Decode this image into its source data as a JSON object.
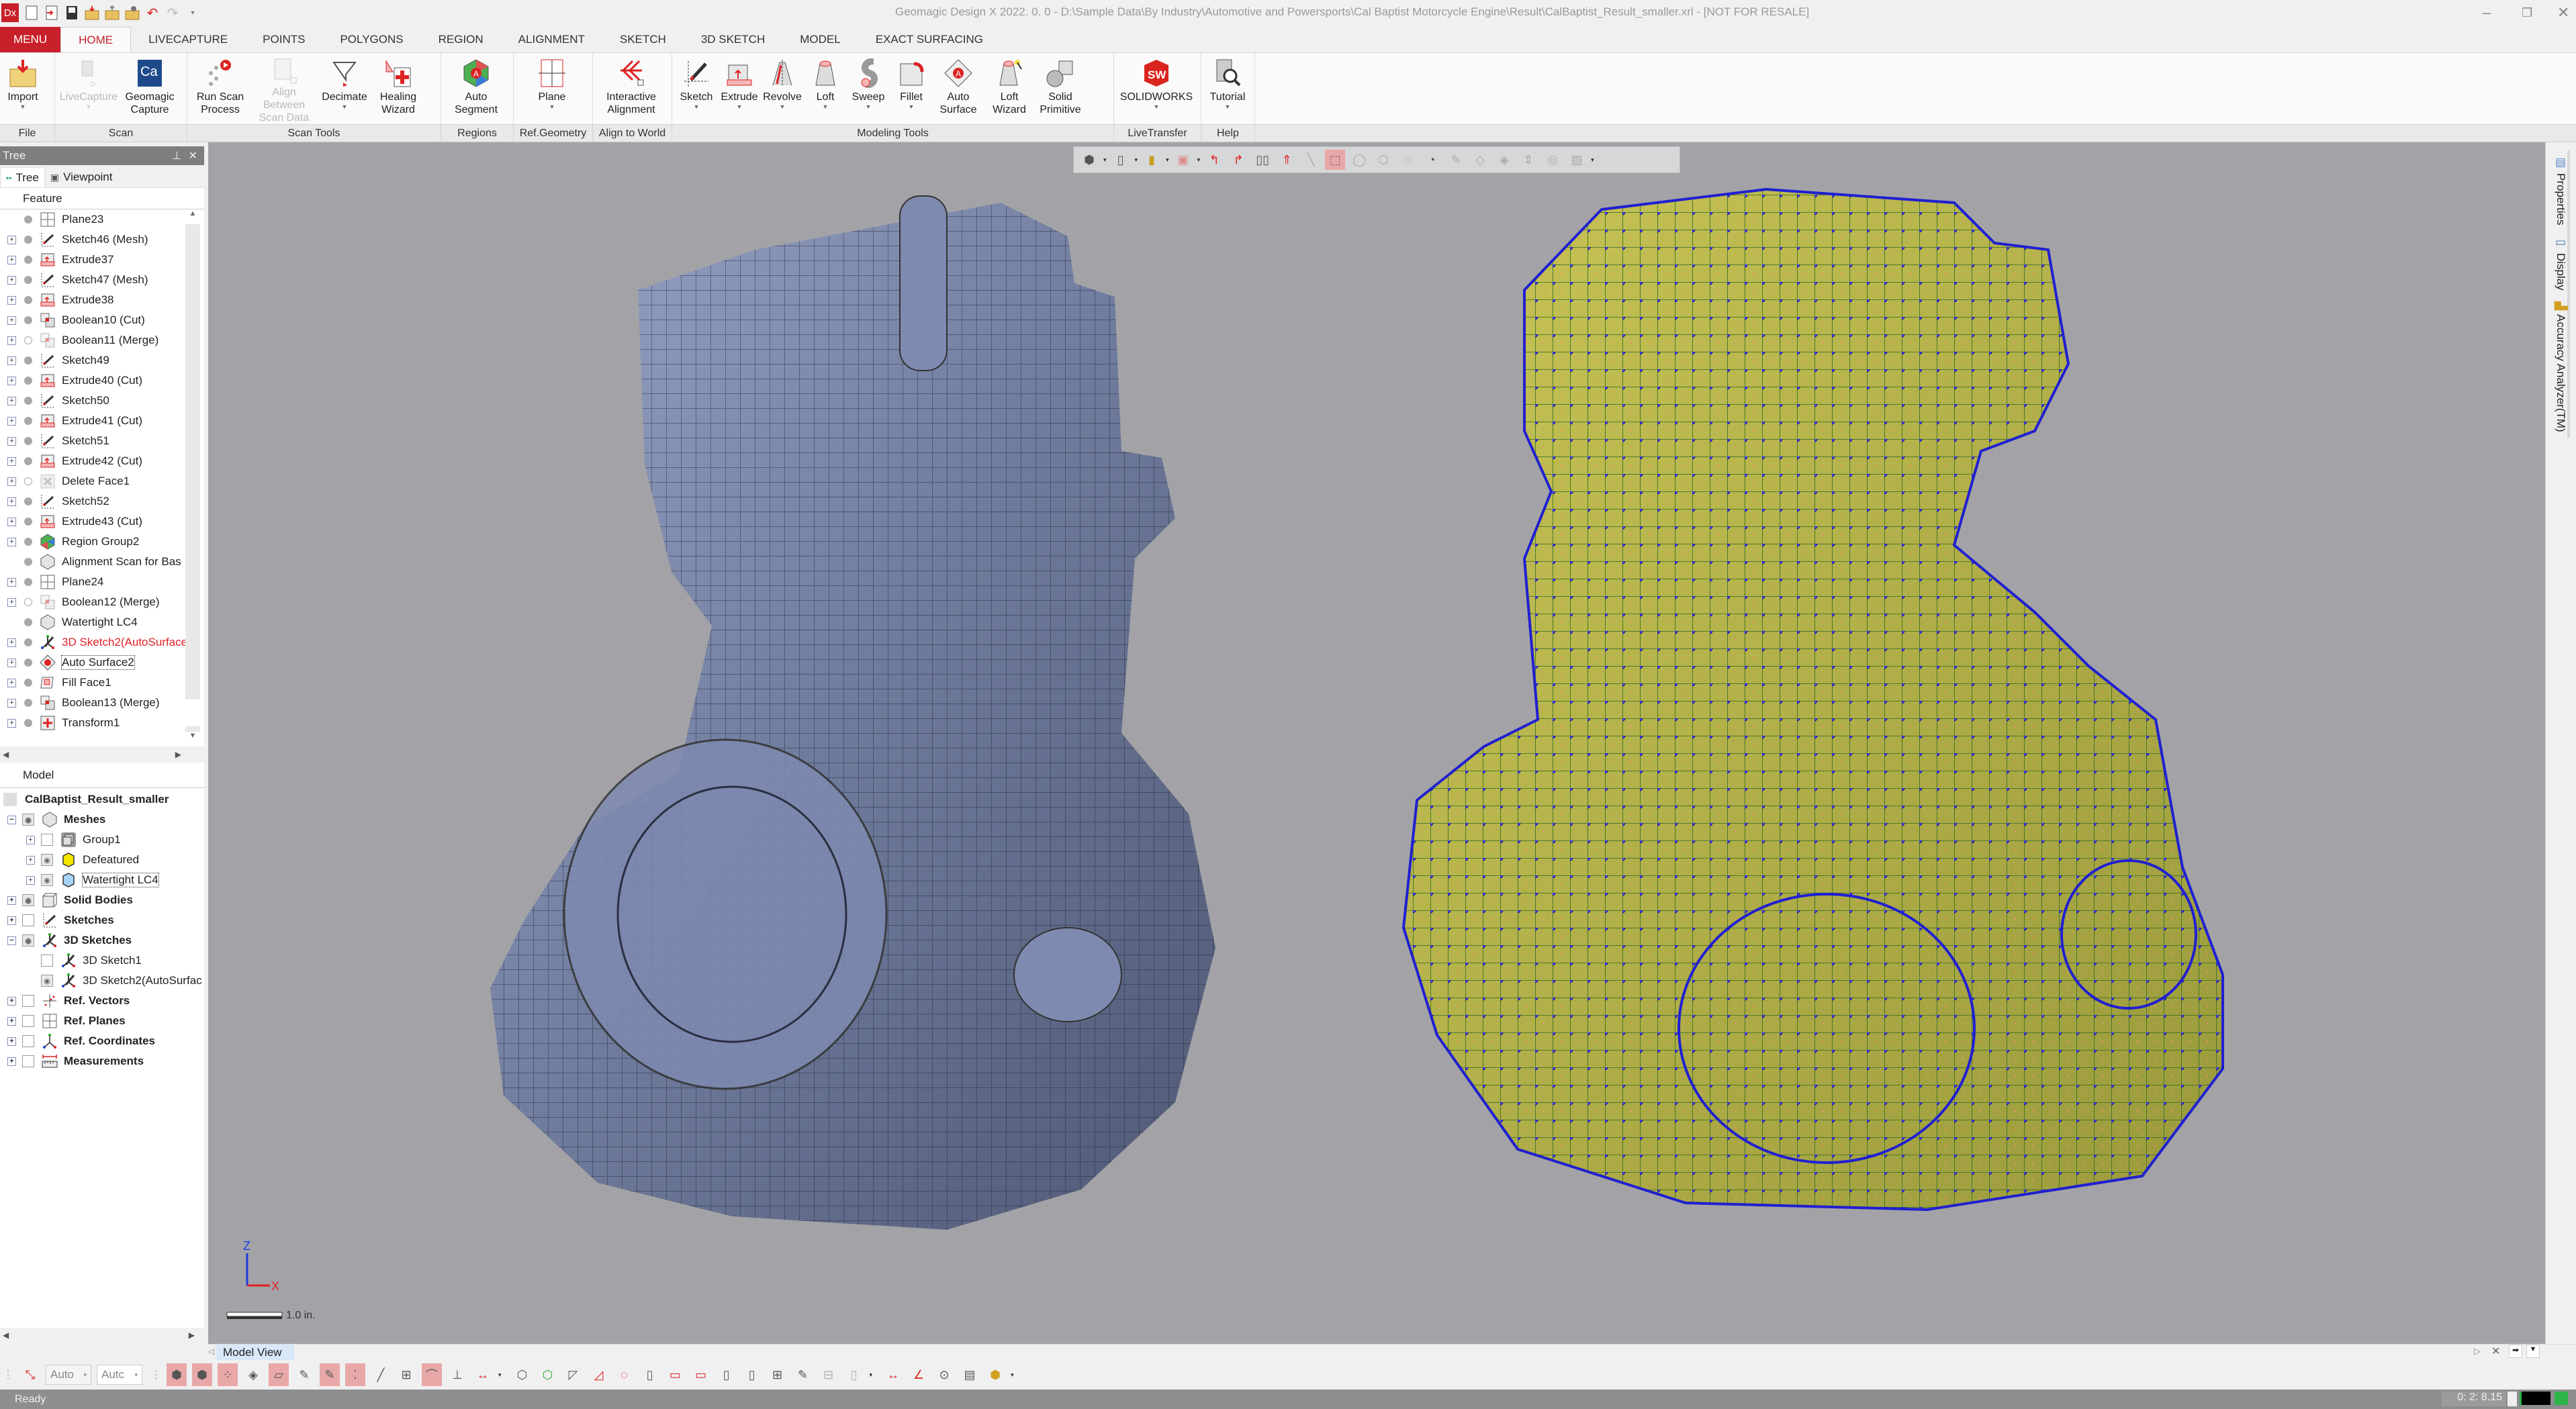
{
  "app": {
    "logo": "Dx",
    "title": "Geomagic Design X 2022. 0. 0 - D:\\Sample Data\\By Industry\\Automotive and Powersports\\Cal Baptist Motorcycle Engine\\Result\\CalBaptist_Result_smaller.xrl - [NOT FOR RESALE]",
    "window_controls": [
      "minimize",
      "restore",
      "close"
    ],
    "quick_access": [
      "new-file-icon",
      "import-file-icon",
      "save-icon",
      "open-folder-icon",
      "export-folder-icon",
      "settings-folder-icon",
      "undo-icon",
      "redo-icon",
      "customize-icon"
    ]
  },
  "ribbon": {
    "menu_label": "MENU",
    "tabs": [
      "HOME",
      "LIVECAPTURE",
      "POINTS",
      "POLYGONS",
      "REGION",
      "ALIGNMENT",
      "SKETCH",
      "3D SKETCH",
      "MODEL",
      "EXACT SURFACING"
    ],
    "active_tab": "HOME",
    "groups": [
      {
        "label": "File",
        "buttons": [
          {
            "label": "Import",
            "icon": "import-icon",
            "dropdown": true
          }
        ]
      },
      {
        "label": "Scan",
        "buttons": [
          {
            "label": "LiveCapture",
            "icon": "livecapture-icon",
            "dropdown": true,
            "disabled": true
          },
          {
            "label": "Geomagic\nCapture",
            "icon": "geomagic-capture-icon",
            "dropdown": true
          }
        ]
      },
      {
        "label": "Scan Tools",
        "buttons": [
          {
            "label": "Run Scan\nProcess",
            "icon": "run-scan-process-icon",
            "dropdown": true
          },
          {
            "label": "Align Between\nScan Data",
            "icon": "align-between-icon",
            "disabled": true
          },
          {
            "label": "Decimate",
            "icon": "decimate-icon",
            "dropdown": true
          },
          {
            "label": "Healing\nWizard",
            "icon": "healing-wizard-icon"
          }
        ]
      },
      {
        "label": "Regions",
        "buttons": [
          {
            "label": "Auto\nSegment",
            "icon": "auto-segment-icon",
            "dropdown": true
          }
        ]
      },
      {
        "label": "Ref.Geometry",
        "buttons": [
          {
            "label": "Plane",
            "icon": "plane-icon",
            "dropdown": true
          }
        ]
      },
      {
        "label": "Align to World",
        "buttons": [
          {
            "label": "Interactive\nAlignment",
            "icon": "interactive-alignment-icon",
            "dropdown": true
          }
        ]
      },
      {
        "label": "Modeling Tools",
        "buttons": [
          {
            "label": "Sketch",
            "icon": "sketch-icon",
            "dropdown": true
          },
          {
            "label": "Extrude",
            "icon": "extrude-icon",
            "dropdown": true
          },
          {
            "label": "Revolve",
            "icon": "revolve-icon",
            "dropdown": true
          },
          {
            "label": "Loft",
            "icon": "loft-icon",
            "dropdown": true
          },
          {
            "label": "Sweep",
            "icon": "sweep-icon",
            "dropdown": true
          },
          {
            "label": "Fillet",
            "icon": "fillet-icon",
            "dropdown": true
          },
          {
            "label": "Auto\nSurface",
            "icon": "auto-surface-icon",
            "dropdown": true
          },
          {
            "label": "Loft\nWizard",
            "icon": "loft-wizard-icon",
            "dropdown": true
          },
          {
            "label": "Solid\nPrimitive",
            "icon": "solid-primitive-icon",
            "dropdown": true
          }
        ]
      },
      {
        "label": "LiveTransfer",
        "buttons": [
          {
            "label": "SOLIDWORKS",
            "icon": "solidworks-icon",
            "dropdown": true
          }
        ]
      },
      {
        "label": "Help",
        "buttons": [
          {
            "label": "Tutorial",
            "icon": "tutorial-icon",
            "dropdown": true
          }
        ]
      }
    ]
  },
  "left_panel": {
    "title": "Tree",
    "tabs": [
      "Tree",
      "Viewpoint"
    ],
    "feature_header": "Feature",
    "features": [
      {
        "label": "Plane23",
        "icon": "plane-icon",
        "expandable": false,
        "suppressed": false
      },
      {
        "label": "Sketch46 (Mesh)",
        "icon": "sketch-icon",
        "expandable": true,
        "suppressed": false
      },
      {
        "label": "Extrude37",
        "icon": "extrude-icon",
        "expandable": true,
        "suppressed": false
      },
      {
        "label": "Sketch47 (Mesh)",
        "icon": "sketch-icon",
        "expandable": true,
        "suppressed": false
      },
      {
        "label": "Extrude38",
        "icon": "extrude-icon",
        "expandable": true,
        "suppressed": false
      },
      {
        "label": "Boolean10 (Cut)",
        "icon": "boolean-icon",
        "expandable": true,
        "suppressed": false
      },
      {
        "label": "Boolean11 (Merge)",
        "icon": "boolean-icon",
        "expandable": true,
        "suppressed": true
      },
      {
        "label": "Sketch49",
        "icon": "sketch-icon",
        "expandable": true,
        "suppressed": false
      },
      {
        "label": "Extrude40 (Cut)",
        "icon": "extrude-icon",
        "expandable": true,
        "suppressed": false
      },
      {
        "label": "Sketch50",
        "icon": "sketch-icon",
        "expandable": true,
        "suppressed": false
      },
      {
        "label": "Extrude41 (Cut)",
        "icon": "extrude-icon",
        "expandable": true,
        "suppressed": false
      },
      {
        "label": "Sketch51",
        "icon": "sketch-icon",
        "expandable": true,
        "suppressed": false
      },
      {
        "label": "Extrude42 (Cut)",
        "icon": "extrude-icon",
        "expandable": true,
        "suppressed": false
      },
      {
        "label": "Delete Face1",
        "icon": "delete-face-icon",
        "expandable": true,
        "suppressed": true
      },
      {
        "label": "Sketch52",
        "icon": "sketch-icon",
        "expandable": true,
        "suppressed": false
      },
      {
        "label": "Extrude43 (Cut)",
        "icon": "extrude-icon",
        "expandable": true,
        "suppressed": false
      },
      {
        "label": "Region Group2",
        "icon": "region-group-icon",
        "expandable": true,
        "suppressed": false
      },
      {
        "label": "Alignment Scan for Bas",
        "icon": "mesh-icon",
        "expandable": false,
        "suppressed": false
      },
      {
        "label": "Plane24",
        "icon": "plane-icon",
        "expandable": true,
        "suppressed": false
      },
      {
        "label": "Boolean12 (Merge)",
        "icon": "boolean-icon",
        "expandable": true,
        "suppressed": true
      },
      {
        "label": "Watertight LC4",
        "icon": "mesh-icon",
        "expandable": false,
        "suppressed": false
      },
      {
        "label": "3D Sketch2(AutoSurface",
        "icon": "3d-sketch-icon",
        "expandable": true,
        "suppressed": false,
        "error": true
      },
      {
        "label": "Auto Surface2",
        "icon": "auto-surface-icon",
        "expandable": true,
        "suppressed": false,
        "selected": true
      },
      {
        "label": "Fill Face1",
        "icon": "fill-face-icon",
        "expandable": true,
        "suppressed": false
      },
      {
        "label": "Boolean13 (Merge)",
        "icon": "boolean-icon",
        "expandable": true,
        "suppressed": false
      },
      {
        "label": "Transform1",
        "icon": "transform-icon",
        "expandable": true,
        "suppressed": false
      }
    ],
    "model_header": "Model",
    "model_root": "CalBaptist_Result_smaller",
    "model_items": [
      {
        "label": "Meshes",
        "level": 0,
        "bold": true,
        "expander": "minus",
        "visible": true,
        "icon": "mesh-icon"
      },
      {
        "label": "Group1",
        "level": 1,
        "bold": false,
        "expander": "plus",
        "visible": false,
        "icon": "group-icon"
      },
      {
        "label": "Defeatured",
        "level": 1,
        "bold": false,
        "expander": "plus",
        "visible": true,
        "icon": "yellow-mesh-icon"
      },
      {
        "label": "Watertight LC4",
        "level": 1,
        "bold": false,
        "expander": "plus",
        "visible": true,
        "icon": "blue-mesh-icon",
        "selected": true
      },
      {
        "label": "Solid Bodies",
        "level": 0,
        "bold": true,
        "expander": "plus",
        "visible": true,
        "icon": "solid-body-icon"
      },
      {
        "label": "Sketches",
        "level": 0,
        "bold": true,
        "expander": "plus",
        "visible": false,
        "icon": "sketch-icon"
      },
      {
        "label": "3D Sketches",
        "level": 0,
        "bold": true,
        "expander": "minus",
        "visible": true,
        "icon": "3d-sketch-icon"
      },
      {
        "label": "3D Sketch1",
        "level": 1,
        "bold": false,
        "expander": "none",
        "visible": false,
        "icon": "3d-sketch-icon"
      },
      {
        "label": "3D Sketch2(AutoSurfac",
        "level": 1,
        "bold": false,
        "expander": "none",
        "visible": true,
        "icon": "3d-sketch-icon"
      },
      {
        "label": "Ref. Vectors",
        "level": 0,
        "bold": true,
        "expander": "plus",
        "visible": false,
        "icon": "ref-vector-icon"
      },
      {
        "label": "Ref. Planes",
        "level": 0,
        "bold": true,
        "expander": "plus",
        "visible": false,
        "icon": "plane-icon"
      },
      {
        "label": "Ref. Coordinates",
        "level": 0,
        "bold": true,
        "expander": "plus",
        "visible": false,
        "icon": "ref-coordinate-icon"
      },
      {
        "label": "Measurements",
        "level": 0,
        "bold": true,
        "expander": "plus",
        "visible": false,
        "icon": "measurement-icon"
      }
    ]
  },
  "viewport": {
    "left_model": "Watertight mesh engine (blue-gray shaded with quad wireframe)",
    "right_model": "Auto surface network engine (yellow with blue control points)",
    "axis": {
      "z": "Z",
      "x": "X"
    },
    "scale_label": "1.0 in."
  },
  "view_toolbar": [
    "mesh-display-icon",
    "view-box-icon",
    "color-map-icon",
    "section-view-icon",
    "rotate-left-icon",
    "rotate-right-icon",
    "flip-icon",
    "normal-up-icon",
    "line-select-icon",
    "rectangle-select-icon",
    "circle-select-icon",
    "polygon-select-icon",
    "freeform-select-icon",
    "lasso-select-icon",
    "paint-brush-select-icon",
    "extension-select-icon",
    "smart-select-icon",
    "sweep-select-icon",
    "visible-only-icon",
    "filter-icon"
  ],
  "right_dock": {
    "tabs": [
      "Properties",
      "Display",
      "Accuracy Analyzer(TM)"
    ]
  },
  "bottom": {
    "view_tab": "Model View",
    "combo1": "Auto",
    "combo2": "Autc",
    "status": "Ready",
    "timer": "0: 2: 8.15",
    "status_color": "#2db34a"
  },
  "colors": {
    "accent": "#c8202a",
    "viewport_bg": "#a3a3a7",
    "error_text": "#e0202a"
  }
}
